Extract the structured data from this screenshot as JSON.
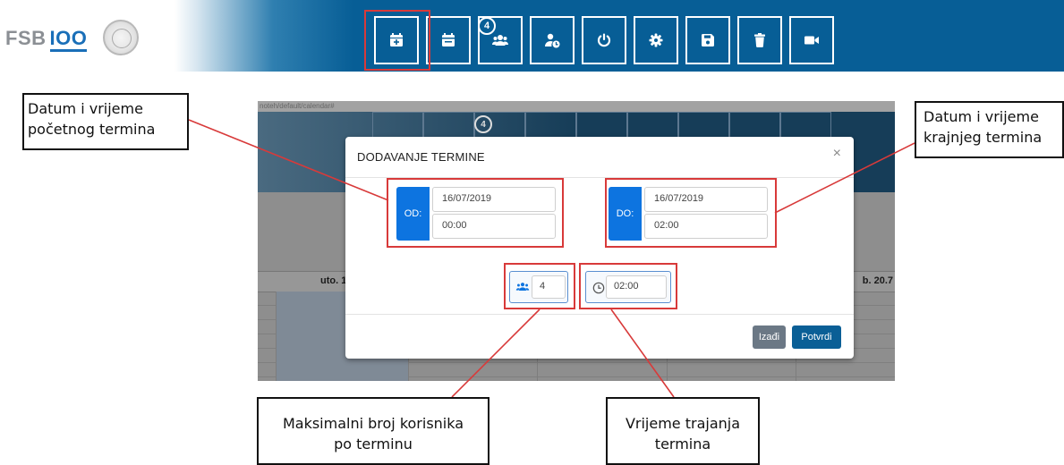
{
  "header": {
    "logo_fsb": "FSB",
    "logo_100": "IOO",
    "seal_icon": "university-seal-icon",
    "badge_count": "4",
    "toolbar": [
      {
        "icon": "calendar-plus-icon"
      },
      {
        "icon": "calendar-icon"
      },
      {
        "icon": "users-icon"
      },
      {
        "icon": "user-clock-icon"
      },
      {
        "icon": "power-icon"
      },
      {
        "icon": "gear-icon"
      },
      {
        "icon": "save-icon"
      },
      {
        "icon": "trash-icon"
      },
      {
        "icon": "video-camera-icon"
      }
    ]
  },
  "background": {
    "url_text": "noteh/default/calendar#",
    "badge_count": "4",
    "day_left": "uto. 1",
    "day_right": "b. 20.7"
  },
  "modal": {
    "title": "DODAVANJE TERMINE",
    "close": "×",
    "from": {
      "label": "OD:",
      "date": "16/07/2019",
      "time": "00:00"
    },
    "to": {
      "label": "DO:",
      "date": "16/07/2019",
      "time": "02:00"
    },
    "max_users": "4",
    "duration": "02:00",
    "exit_label": "Izađi",
    "confirm_label": "Potvrdi"
  },
  "callouts": {
    "start": [
      "Datum i vrijeme",
      "početnog termina"
    ],
    "end": [
      "Datum i vrijeme",
      "krajnjeg termina"
    ],
    "max_users": [
      "Maksimalni broj korisnika",
      "po terminu"
    ],
    "duration": [
      "Vrijeme trajanja",
      "termina"
    ]
  },
  "colors": {
    "brand_blue": "#075e96",
    "accent_blue": "#0d74e0",
    "annotation_red": "#d83a3a"
  }
}
